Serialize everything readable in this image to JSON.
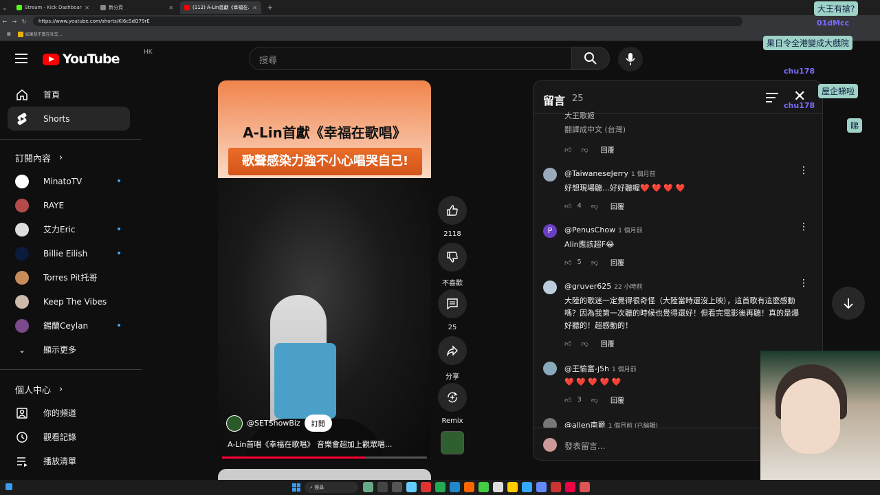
{
  "browser": {
    "tabs": [
      {
        "title": "Stream - Kick Dashboard",
        "color": "#53fc18"
      },
      {
        "title": "新分頁",
        "color": "#888888"
      },
      {
        "title": "(112) A-Lin首獻《幸福在...",
        "color": "#ff0000"
      }
    ],
    "url": "https://www.youtube.com/shorts/KI6cSdO79rE",
    "bookmark": "如果我不算在社交..."
  },
  "youtube": {
    "logo": "YouTube",
    "region": "HK",
    "search_placeholder": "搜尋"
  },
  "sidebar": {
    "home": "首頁",
    "shorts": "Shorts",
    "subscriptions_title": "訂閱內容",
    "channels": [
      {
        "name": "MinatoTV",
        "color": "#ffffff",
        "new": true
      },
      {
        "name": "RAYE",
        "color": "#b44a4a",
        "new": false
      },
      {
        "name": "艾力Eric",
        "color": "#dddddd",
        "new": true
      },
      {
        "name": "Billie Eilish",
        "color": "#0b1b3b",
        "new": true
      },
      {
        "name": "Torres Pit托哥",
        "color": "#c88b5a",
        "new": false
      },
      {
        "name": "Keep The Vibes",
        "color": "#ccbbaa",
        "new": false
      },
      {
        "name": "錫蘭Ceylan",
        "color": "#7a4a8a",
        "new": true
      }
    ],
    "show_more": "顯示更多",
    "you_title": "個人中心",
    "your_channel": "你的頻道",
    "history": "觀看記錄",
    "playlists": "播放清單"
  },
  "video": {
    "banner_line1": "A-Lin首獻《幸福在歌唱》",
    "banner_line2": "歌聲感染力強不小心唱哭自己!",
    "channel": "@SETShowBiz",
    "subscribe": "訂閱",
    "title": "A-Lin首唱《幸福在歌唱》 音樂會超加上觀眾唱...",
    "progress": 0.7
  },
  "actions": {
    "like_count": "2118",
    "dislike": "不喜歡",
    "comments": "25",
    "share": "分享",
    "remix": "Remix"
  },
  "comments": {
    "title": "留言",
    "count": "25",
    "items": [
      {
        "partial_text": "大王歌姬",
        "translate": "翻譯成中文 (台灣)",
        "reply": "回覆"
      },
      {
        "author": "@TaiwaneseJerry",
        "time": "1 個月前",
        "text": "好想現場聽…好好聽喔❤️ ❤️ ❤️ ❤️",
        "likes": "4",
        "reply": "回覆",
        "avatar": "#9ab"
      },
      {
        "author": "@PenusChow",
        "time": "1 個月前",
        "text": "Alin應該超F😂",
        "likes": "5",
        "reply": "回覆",
        "avatar": "#6a3fc2",
        "initial": "P"
      },
      {
        "author": "@gruver625",
        "time": "22 小時前",
        "text": "大陸的歌迷一定覺得很奇怪（大陸當時還沒上映），這首歌有這麼感動嗎？因為我第一次聽的時候也覺得還好！但看完電影後再聽！真的是爆好聽的！超感動的！",
        "likes": "",
        "reply": "回覆",
        "avatar": "#bcd"
      },
      {
        "author": "@王愉富-j5h",
        "time": "1 個月前",
        "text": "❤️ ❤️ ❤️ ❤️ ❤️",
        "likes": "3",
        "reply": "回覆",
        "avatar": "#8ab"
      },
      {
        "author": "@allen南爵",
        "time": "1 個月前 (已編輯)",
        "avatar": "#777"
      }
    ],
    "add_placeholder": "發表留言..."
  },
  "stream_chat": [
    {
      "kind": "bubble",
      "text": "大王有搶?"
    },
    {
      "kind": "name",
      "text": "01dMcc"
    },
    {
      "kind": "bubble",
      "text": "果日令全港變成大戲院"
    },
    {
      "kind": "name",
      "text": "chu178"
    },
    {
      "kind": "bubble",
      "text": "屋企睇啦"
    },
    {
      "kind": "name",
      "text": "chu178"
    },
    {
      "kind": "bubble",
      "text": "睇"
    }
  ],
  "taskbar": {
    "search": "搜尋"
  }
}
